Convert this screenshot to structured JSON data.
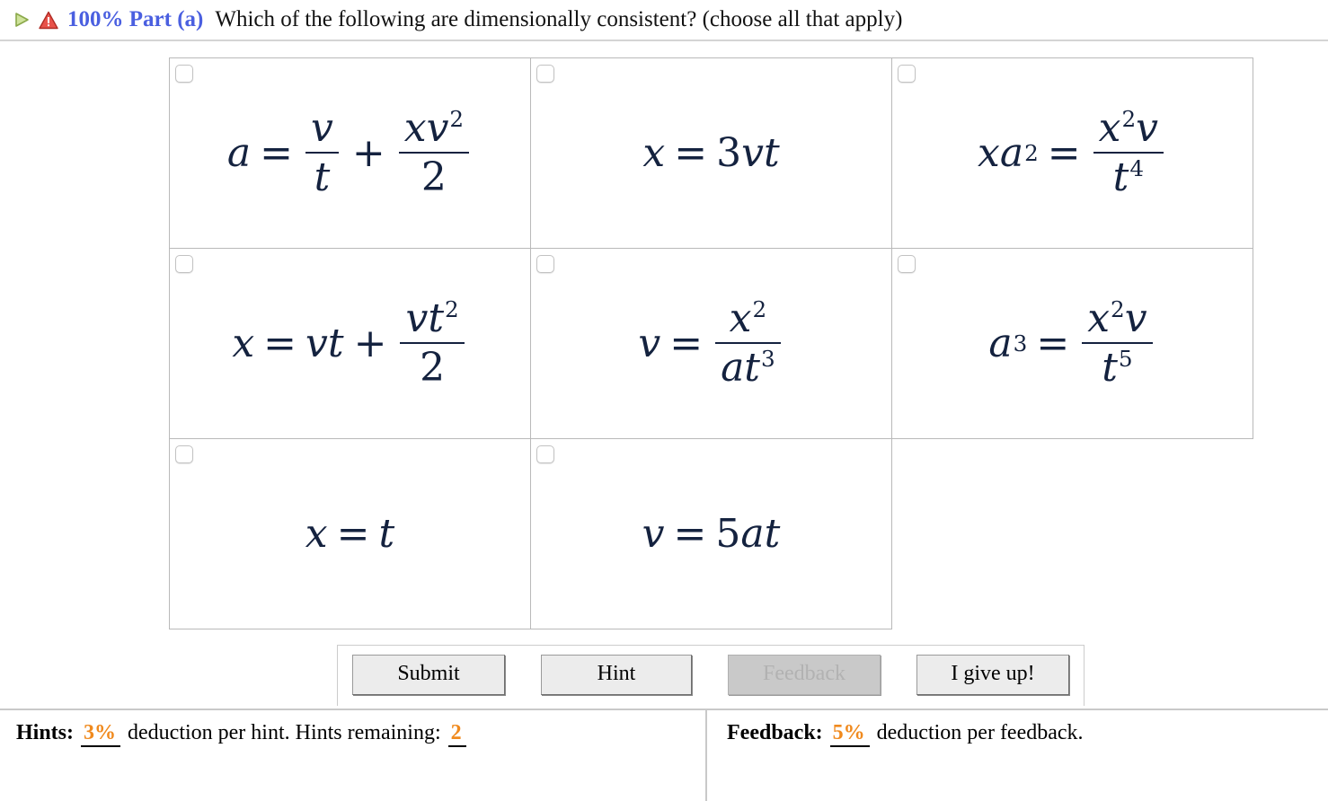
{
  "header": {
    "play_icon": "play-triangle-icon",
    "warning_icon": "warning-triangle-icon",
    "score_part": "100% Part (a)",
    "question": "Which of the following are dimensionally consistent? (choose all that apply)"
  },
  "options": [
    {
      "id": "option-1",
      "checked": false,
      "formula_text": "a = v/t + xv^2/2",
      "parts": {
        "lhs": "a",
        "eq": "=",
        "f1_num": "v",
        "f1_den": "t",
        "plus": "+",
        "f2_num_x": "x",
        "f2_num_v": "v",
        "f2_num_exp": "2",
        "f2_den": "2"
      }
    },
    {
      "id": "option-2",
      "checked": false,
      "formula_text": "x = 3vt",
      "parts": {
        "lhs": "x",
        "eq": "=",
        "coef": "3",
        "v": "v",
        "t": "t"
      }
    },
    {
      "id": "option-3",
      "checked": false,
      "formula_text": "xa^2 = x^2 v / t^4",
      "parts": {
        "lhs_x": "x",
        "lhs_a": "a",
        "lhs_exp": "2",
        "eq": "=",
        "num_x": "x",
        "num_exp": "2",
        "num_v": "v",
        "den_t": "t",
        "den_exp": "4"
      }
    },
    {
      "id": "option-4",
      "checked": false,
      "formula_text": "x = vt + vt^2/2",
      "parts": {
        "lhs": "x",
        "eq": "=",
        "v": "v",
        "t": "t",
        "plus": "+",
        "num_v": "v",
        "num_t": "t",
        "num_exp": "2",
        "den": "2"
      }
    },
    {
      "id": "option-5",
      "checked": false,
      "formula_text": "v = x^2 / (a t^3)",
      "parts": {
        "lhs": "v",
        "eq": "=",
        "num_x": "x",
        "num_exp": "2",
        "den_a": "a",
        "den_t": "t",
        "den_exp": "3"
      }
    },
    {
      "id": "option-6",
      "checked": false,
      "formula_text": "a^3 = x^2 v / t^5",
      "parts": {
        "lhs_a": "a",
        "lhs_exp": "3",
        "eq": "=",
        "num_x": "x",
        "num_exp": "2",
        "num_v": "v",
        "den_t": "t",
        "den_exp": "5"
      }
    },
    {
      "id": "option-7",
      "checked": false,
      "formula_text": "x = t",
      "parts": {
        "lhs": "x",
        "eq": "=",
        "rhs": "t"
      }
    },
    {
      "id": "option-8",
      "checked": false,
      "formula_text": "v = 5at",
      "parts": {
        "lhs": "v",
        "eq": "=",
        "coef": "5",
        "a": "a",
        "t": "t"
      }
    }
  ],
  "buttons": {
    "submit": "Submit",
    "hint": "Hint",
    "feedback": "Feedback",
    "give_up": "I give up!"
  },
  "footer": {
    "hints_label": "Hints:",
    "hints_pct": "3%",
    "hints_text_mid": "deduction per hint. Hints remaining:",
    "hints_remaining": "2",
    "feedback_label": "Feedback:",
    "feedback_pct": "5%",
    "feedback_text": "deduction per feedback."
  },
  "colors": {
    "accent_blue": "#4a5fe0",
    "accent_orange": "#f08a1e",
    "math_ink": "#14223f",
    "border_gray": "#b9b9b9"
  }
}
